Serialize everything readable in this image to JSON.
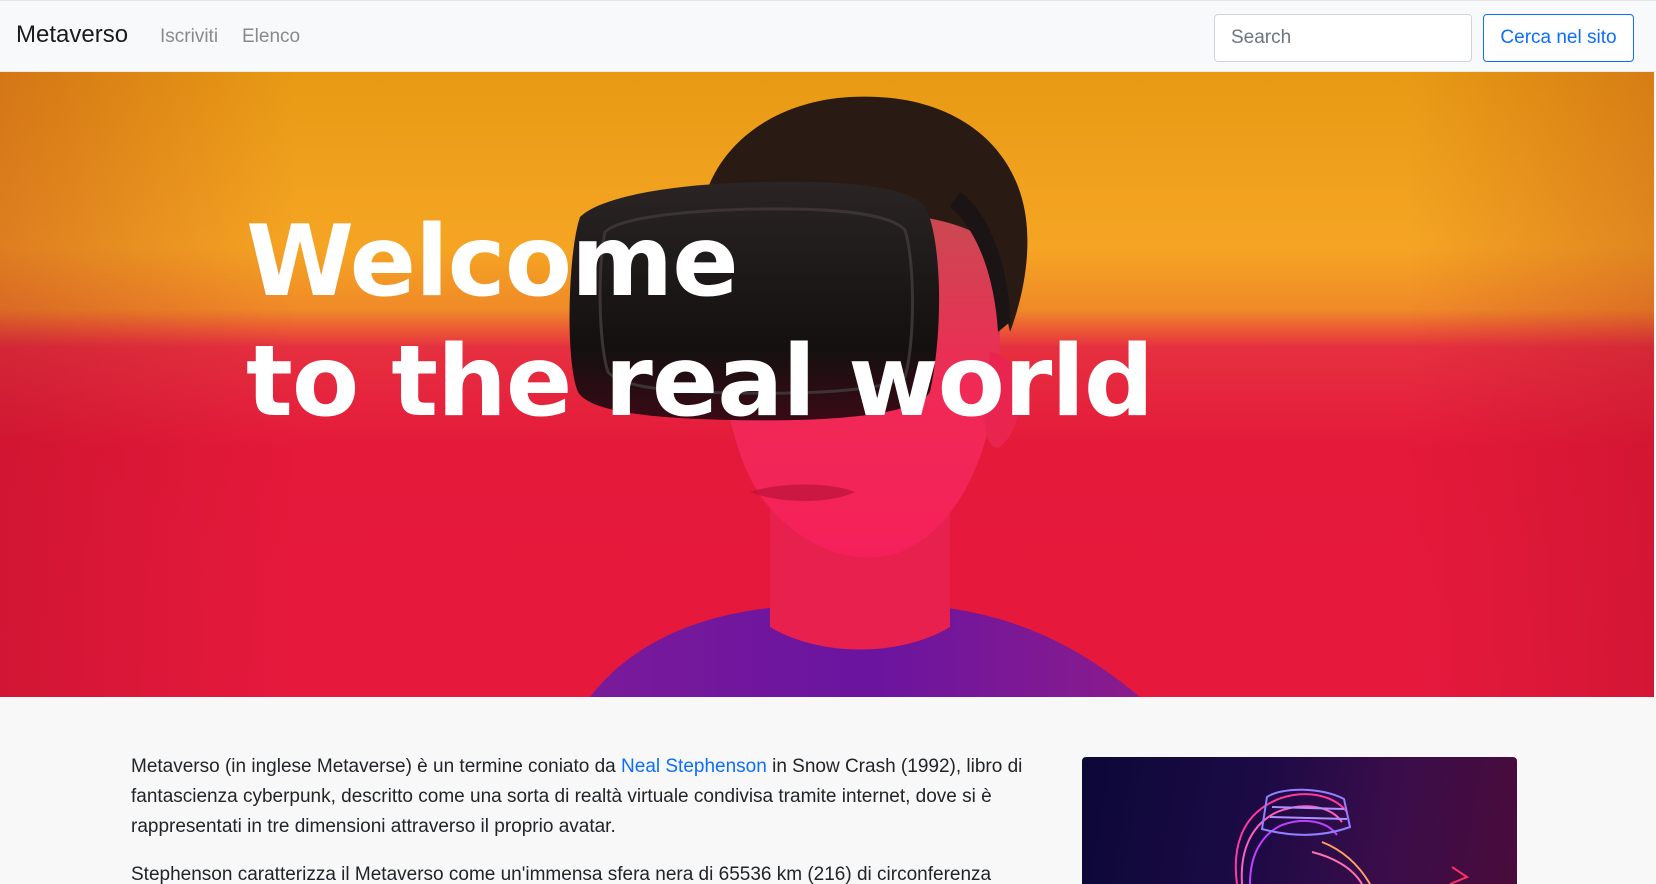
{
  "navbar": {
    "brand": "Metaverso",
    "links": [
      {
        "label": "Iscriviti"
      },
      {
        "label": "Elenco"
      }
    ],
    "search": {
      "placeholder": "Search",
      "value": ""
    },
    "search_button": "Cerca nel sito"
  },
  "hero": {
    "title_line1": "Welcome",
    "title_line2": "to the real world"
  },
  "content": {
    "p1_before": "Metaverso (in inglese Metaverse) è un termine coniato da ",
    "p1_link": "Neal Stephenson",
    "p1_after": " in Snow Crash (1992), libro di fantascienza cyberpunk, descritto come una sorta di realtà virtuale condivisa tramite internet, dove si è rappresentati in tre dimensioni attraverso il proprio avatar.",
    "p2": "Stephenson caratterizza il Metaverso come un'immensa sfera nera di 65536 km (216) di circonferenza"
  },
  "colors": {
    "accent": "#0d6efd",
    "hero_orange": "#f5a523",
    "hero_red": "#e5193a"
  },
  "icons": {
    "hero_image": "person-wearing-vr-headset",
    "side_image": "neon-vr-wireframe-figure"
  }
}
